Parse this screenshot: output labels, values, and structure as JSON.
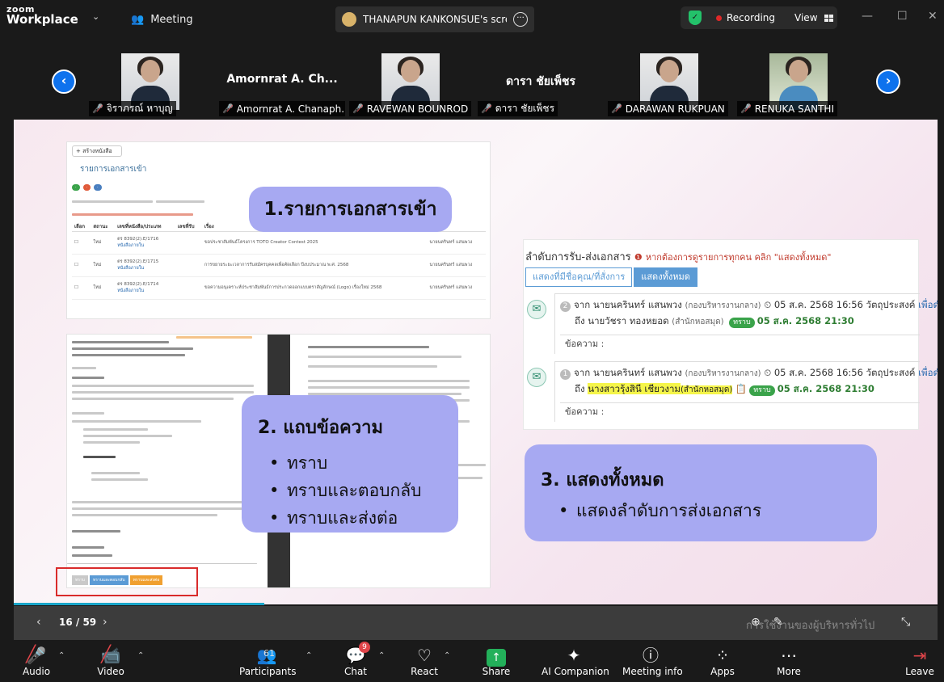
{
  "app": {
    "brand_top": "zoom",
    "brand_bottom": "Workplace",
    "meeting_label": "Meeting",
    "share_title": "THANAPUN KANKONSUE's screen",
    "recording_label": "Recording",
    "view_label": "View"
  },
  "gallery": {
    "tiles": [
      {
        "name": "จิราภรณ์  หาบุญ",
        "big": ""
      },
      {
        "name": "Amornrat A. Chanaph...",
        "big": "Amornrat A. Ch..."
      },
      {
        "name": "RAVEWAN BOUNROD",
        "big": ""
      },
      {
        "name": "ดารา ชัยเพ็ชร",
        "big": "ดารา ชัยเพ็ชร"
      },
      {
        "name": "DARAWAN RUKPUAN",
        "big": ""
      },
      {
        "name": "RENUKA SANTHI",
        "big": ""
      }
    ]
  },
  "slide": {
    "create_btn": "+ สร้างหนังสือ",
    "list_header": "รายการเอกสารเข้า",
    "table_headers": [
      "เลือก",
      "สถานะ",
      "เลขที่หนังสือ/ประเภท",
      "เลขที่รับ",
      "เรื่อง",
      "",
      "ผู้ส่ง"
    ],
    "rows": [
      {
        "status": "ใหม่",
        "no": "ตร 8392(2).E/1716",
        "type": "หนังสือภายใน",
        "subject": "ขอประชาสัมพันธ์โครงการ TOTO Creator Contest 2025",
        "sender": "นายนครินทร์ แสนพวง"
      },
      {
        "status": "ใหม่",
        "no": "ตร 8392(2).E/1715",
        "type": "หนังสือภายใน",
        "subject": "การขยายระยะเวลาการรับสมัครบุคคลเพื่อคัดเลือก ปีงบประมาณ พ.ศ. 2568",
        "sender": "นายนครินทร์ แสนพวง"
      },
      {
        "status": "ใหม่",
        "no": "ตร 8392(2).E/1714",
        "type": "หนังสือภายใน",
        "subject": "ขอความอนุเคราะห์ประชาสัมพันธ์การประกวดออกแบบตราสัญลักษณ์ (Logo) เรื่องใหม่ 2568",
        "sender": "นายนครินทร์ แสนพวง"
      }
    ],
    "doc_buttons": [
      "ทราบ",
      "ทราบและตอบกลับ",
      "ทราบและส่งต่อ"
    ],
    "callout1": "1.รายการเอกสารเข้า",
    "callout2": {
      "title": "2. แถบข้อความ",
      "items": [
        "ทราบ",
        "ทราบและตอบกลับ",
        "ทราบและส่งต่อ"
      ]
    },
    "callout3": {
      "title": "3. แสดงทั้งหมด",
      "items": [
        "แสดงลำดับการส่งเอกสาร"
      ]
    },
    "routing": {
      "title": "ลำดับการรับ-ส่งเอกสาร",
      "warning": "หากต้องการดูรายการทุกคน คลิก \"แสดงทั้งหมด\"",
      "tab_mine": "แสดงที่มีชื่อคุณ/ที่สั่งการ",
      "tab_all": "แสดงทั้งหมด",
      "entries": [
        {
          "num": "2",
          "from_prefix": "จาก",
          "from": "นายนครินทร์ แสนพวง",
          "dept": "(กองบริหารงานกลาง)",
          "sent": "05 ส.ค. 2568 16:56",
          "purpose_label": "วัตถุประสงค์",
          "purpose": "เพื่อดำเนินการต่อ",
          "to_prefix": "ถึง",
          "to": "นายวัชรา ทองหยอด",
          "to_dept": "(สำนักหอสมุด)",
          "ack": "ทราบ",
          "ack_time": "05 ส.ค. 2568 21:30",
          "msg_label": "ข้อความ :"
        },
        {
          "num": "1",
          "from_prefix": "จาก",
          "from": "นายนครินทร์ แสนพวง",
          "dept": "(กองบริหารงานกลาง)",
          "sent": "05 ส.ค. 2568 16:56",
          "purpose_label": "วัตถุประสงค์",
          "purpose": "เพื่อดำเนินการต่อ",
          "to_prefix": "ถึง",
          "to": "นางสาวรุ้งสินี เชียวงาม",
          "to_dept": "(สำนักหอสมุด)",
          "ack": "ทราบ",
          "ack_time": "05 ส.ค. 2568 21:30",
          "msg_label": "ข้อความ :"
        }
      ]
    },
    "ghost_text": "การใช้งานของผู้บริหารทั่วไป"
  },
  "slidebar": {
    "page": "16 / 59"
  },
  "toolbar": {
    "audio": "Audio",
    "video": "Video",
    "participants": "Participants",
    "participants_count": "61",
    "chat": "Chat",
    "chat_badge": "9",
    "react": "React",
    "share": "Share",
    "ai": "AI Companion",
    "info": "Meeting info",
    "apps": "Apps",
    "more": "More",
    "leave": "Leave"
  },
  "colors": {
    "callout": "#a7a9f2",
    "zoom_blue": "#0e72ed",
    "share_green": "#23b05a",
    "record_red": "#e02828"
  }
}
